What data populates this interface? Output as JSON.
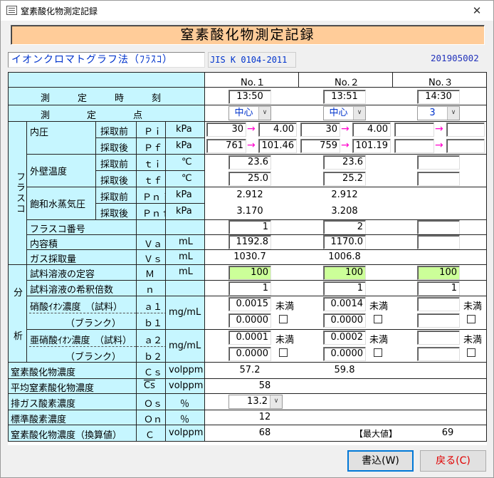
{
  "window": {
    "title": "窒素酸化物測定記録",
    "close": "✕"
  },
  "banner": "窒素酸化物測定記録",
  "method": "イオンクロマトグラフ法（ﾌﾗｽｺ）",
  "jis": "JIS K 0104-2011",
  "record_id": "201905002",
  "columns": [
    "No.１",
    "No.２",
    "No.３"
  ],
  "labels": {
    "time": "測　　　定　　　時　　　刻",
    "point": "測　　　　定　　　　点",
    "flask_group": "フラスコ",
    "analysis_1": "分",
    "analysis_2": "析",
    "inner_pressure": "内圧",
    "wall_temp": "外壁温度",
    "sat_vapor": "飽和水蒸気圧",
    "flask_no": "フラスコ番号",
    "volume": "内容積",
    "gas_sampled": "ガス採取量",
    "before": "採取前",
    "after": "採取後",
    "sample_vol": "試料溶液の定容",
    "dilution": "試料溶液の希釈倍数",
    "nitrate": "硝酸ｲｵﾝ濃度　（試料）",
    "blank": "（ブランク）",
    "nitrite": "亜硝酸ｲｵﾝ濃度　（試料）",
    "nox_conc": "窒素酸化物濃度",
    "avg_nox": "平均窒素酸化物濃度",
    "o2_exhaust": "排ガス酸素濃度",
    "o2_std": "標準酸素濃度",
    "nox_conv": "窒素酸化物濃度（換算値）",
    "max_label": "【最大値】",
    "under": "未満"
  },
  "symbols": {
    "pi": "Ｐｉ",
    "pf": "Ｐｆ",
    "ti": "ｔｉ",
    "tf": "ｔｆ",
    "pni": "Ｐｎｉ",
    "pnf": "Ｐｎｆ",
    "va": "Ｖａ",
    "vs": "Ｖｓ",
    "m": "Ｍ",
    "n": "ｎ",
    "a1": "ａ１",
    "b1": "ｂ１",
    "a2": "ａ２",
    "b2": "ｂ２",
    "cs": "Ｃｓ",
    "csbar": "Cs",
    "os": "Ｏｓ",
    "on": "Ｏｎ",
    "c": "Ｃ"
  },
  "units": {
    "kpa": "kPa",
    "degc": "℃",
    "ml": "mL",
    "mgml": "mg/mL",
    "volppm": "volppm",
    "pct": "％"
  },
  "no1": {
    "time": "13:50",
    "point": "中心",
    "pi_a": "30",
    "pi_b": "4.00",
    "pf_a": "761",
    "pf_b": "101.46",
    "ti": "23.6",
    "tf": "25.0",
    "pni": "2.912",
    "pnf": "3.170",
    "flask": "1",
    "va": "1192.8",
    "vs": "1030.7",
    "m": "100",
    "n": "1",
    "a1": "0.0015",
    "b1": "0.0000",
    "a2": "0.0001",
    "b2": "0.0000",
    "cs": "57.2"
  },
  "no2": {
    "time": "13:51",
    "point": "中心",
    "pi_a": "30",
    "pi_b": "4.00",
    "pf_a": "759",
    "pf_b": "101.19",
    "ti": "23.6",
    "tf": "25.2",
    "pni": "2.912",
    "pnf": "3.208",
    "flask": "2",
    "va": "1170.0",
    "vs": "1006.8",
    "m": "100",
    "n": "1",
    "a1": "0.0014",
    "b1": "0.0000",
    "a2": "0.0002",
    "b2": "0.0000",
    "cs": "59.8"
  },
  "no3": {
    "time": "14:30",
    "point": "3",
    "m": "100",
    "n": "1"
  },
  "avg_nox": "58",
  "o2_exhaust": "13.2",
  "o2_std": "12",
  "nox_conv": "68",
  "nox_max": "69",
  "arrow": "→",
  "combo_arrow": "∨",
  "buttons": {
    "save": "書込(W)",
    "back": "戻る(C)"
  }
}
